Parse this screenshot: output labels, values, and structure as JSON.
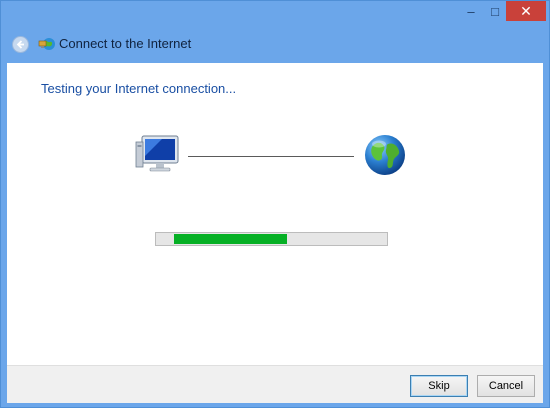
{
  "window": {
    "minimize_glyph": "–",
    "maximize_glyph": "□",
    "close_glyph": "✕"
  },
  "header": {
    "title": "Connect to the Internet",
    "back_icon": "back-arrow-icon",
    "app_icon": "network-globe-icon"
  },
  "content": {
    "heading": "Testing your Internet connection...",
    "computer_icon": "computer-icon",
    "globe_icon": "globe-icon",
    "progress": {
      "start_fraction": 0.08,
      "end_fraction": 0.57,
      "color": "#06b025"
    }
  },
  "footer": {
    "skip_label": "Skip",
    "cancel_label": "Cancel"
  }
}
